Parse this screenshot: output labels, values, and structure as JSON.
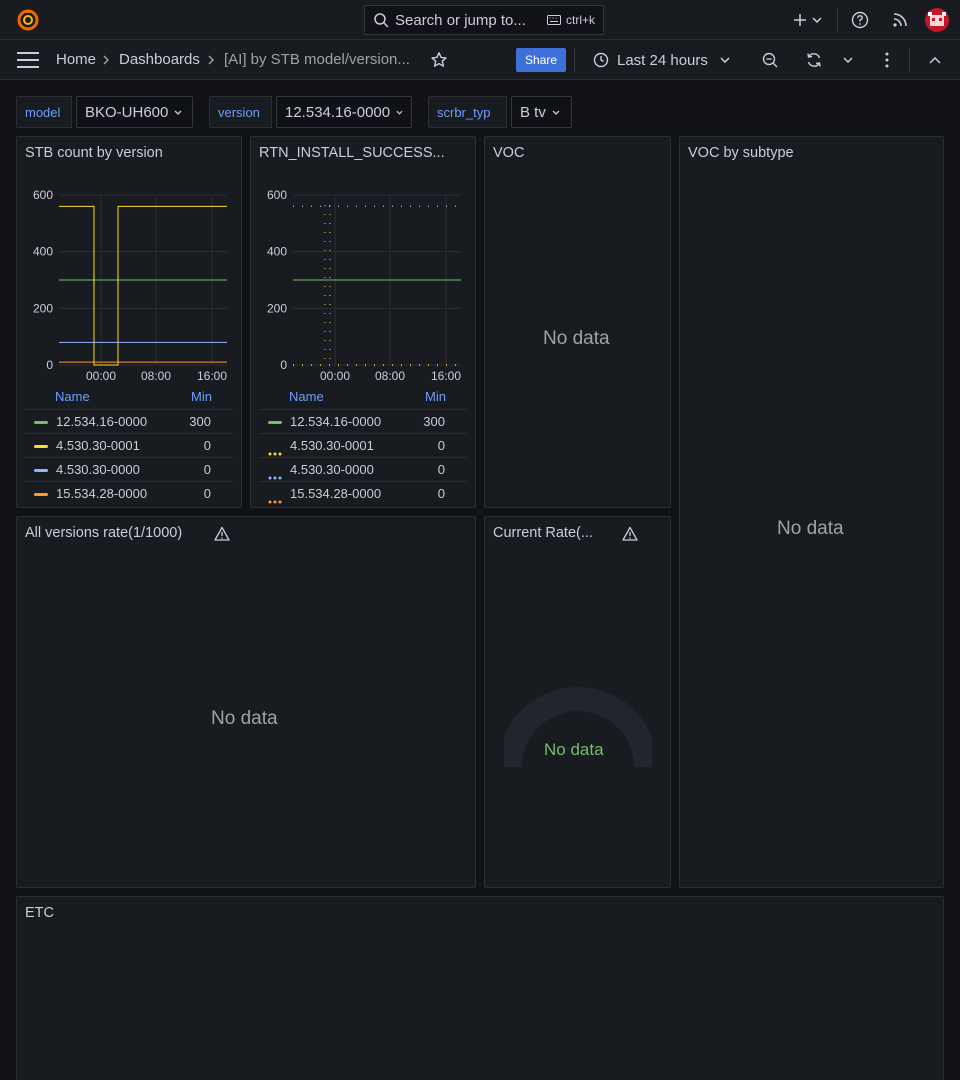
{
  "topbar": {
    "search_placeholder": "Search or jump to...",
    "search_shortcut": "ctrl+k",
    "icons": [
      "grafana-logo",
      "search-icon",
      "keyboard-icon",
      "plus-icon",
      "chevron-down-icon",
      "help-icon",
      "rss-icon",
      "avatar"
    ]
  },
  "navbar": {
    "breadcrumb": [
      "Home",
      "Dashboards",
      "[AI] by STB model/version..."
    ],
    "share_label": "Share",
    "time_range": "Last 24 hours"
  },
  "variables": [
    {
      "label": "model",
      "value": "BKO-UH600"
    },
    {
      "label": "version",
      "value": "12.534.16-0000"
    },
    {
      "label": "scrbr_typ",
      "value": "B tv"
    }
  ],
  "panels": {
    "stb_count": {
      "title": "STB count by version",
      "legend_headers": {
        "name": "Name",
        "min": "Min"
      },
      "legend": [
        {
          "name": "12.534.16-0000",
          "min": "300",
          "color": "#73bf69"
        },
        {
          "name": "4.530.30-0001",
          "min": "0",
          "color": "#fade2a"
        },
        {
          "name": "4.530.30-0000",
          "min": "0",
          "color": "#8ab8ff"
        },
        {
          "name": "15.534.28-0000",
          "min": "0",
          "color": "#ff9830"
        }
      ]
    },
    "rtn_install": {
      "title": "RTN_INSTALL_SUCCESS...",
      "legend_headers": {
        "name": "Name",
        "min": "Min"
      },
      "legend": [
        {
          "name": "12.534.16-0000",
          "min": "300",
          "color": "#73bf69"
        },
        {
          "name": "4.530.30-0001",
          "min": "0",
          "color": "#fade2a"
        },
        {
          "name": "4.530.30-0000",
          "min": "0",
          "color": "#8ab8ff"
        },
        {
          "name": "15.534.28-0000",
          "min": "0",
          "color": "#ff9830"
        }
      ]
    },
    "voc": {
      "title": "VOC",
      "message": "No data"
    },
    "voc_subtype": {
      "title": "VOC by subtype",
      "message": "No data"
    },
    "all_versions": {
      "title": "All versions rate(1/1000)",
      "message": "No data"
    },
    "current_rate": {
      "title": "Current Rate(...",
      "message": "No data"
    },
    "etc": {
      "title": "ETC"
    }
  },
  "chart_data": [
    {
      "type": "line",
      "title": "STB count by version",
      "x_ticks": [
        "00:00",
        "08:00",
        "16:00"
      ],
      "y_ticks": [
        0,
        200,
        400,
        600
      ],
      "ylim": [
        0,
        600
      ],
      "series": [
        {
          "name": "12.534.16-0000",
          "color": "#73bf69",
          "style": "solid",
          "values": [
            300,
            300,
            300,
            300,
            300,
            300,
            300,
            300
          ]
        },
        {
          "name": "4.530.30-0001",
          "color": "#fade2a",
          "style": "solid",
          "values": [
            560,
            560,
            0,
            560,
            560,
            560,
            560,
            560
          ]
        },
        {
          "name": "4.530.30-0000",
          "color": "#8ab8ff",
          "style": "solid",
          "values": [
            80,
            80,
            80,
            80,
            80,
            80,
            80,
            80
          ]
        },
        {
          "name": "15.534.28-0000",
          "color": "#ff9830",
          "style": "solid",
          "values": [
            10,
            10,
            10,
            10,
            10,
            10,
            10,
            10
          ]
        }
      ]
    },
    {
      "type": "line",
      "title": "RTN_INSTALL_SUCCESS...",
      "x_ticks": [
        "00:00",
        "08:00",
        "16:00"
      ],
      "y_ticks": [
        0,
        200,
        400,
        600
      ],
      "ylim": [
        0,
        600
      ],
      "series": [
        {
          "name": "12.534.16-0000",
          "color": "#73bf69",
          "style": "solid",
          "values": [
            300,
            300,
            300,
            300,
            300,
            300,
            300,
            300
          ]
        },
        {
          "name": "4.530.30-0001",
          "color": "#fade2a",
          "style": "dotted",
          "values": [
            0,
            0,
            0,
            0,
            0,
            0,
            0,
            0
          ]
        },
        {
          "name": "4.530.30-0000",
          "color": "#8ab8ff",
          "style": "dotted",
          "values": [
            560,
            560,
            560,
            560,
            560,
            560,
            560,
            560
          ]
        },
        {
          "name": "15.534.28-0000",
          "color": "#ff9830",
          "style": "dotted",
          "values": [
            0,
            0,
            0,
            0,
            0,
            0,
            0,
            0
          ]
        }
      ]
    }
  ]
}
